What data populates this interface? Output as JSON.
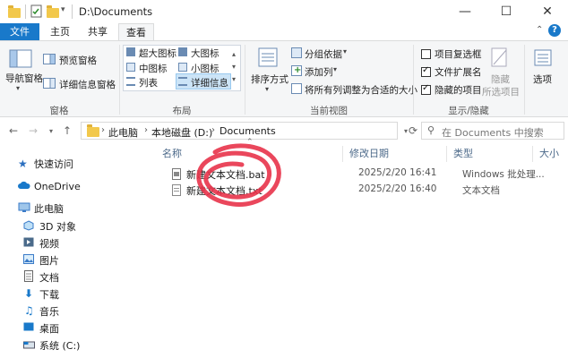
{
  "window": {
    "title": "D:\\Documents"
  },
  "tabs": {
    "file": "文件",
    "home": "主页",
    "share": "共享",
    "view": "查看"
  },
  "ribbon": {
    "panes": {
      "nav_pane": "导航窗格",
      "preview_pane": "预览窗格",
      "details_pane": "详细信息窗格",
      "group": "窗格"
    },
    "layout": {
      "xl_icons": "超大图标",
      "large_icons": "大图标",
      "medium_icons": "中图标",
      "small_icons": "小图标",
      "list": "列表",
      "details": "详细信息",
      "group": "布局"
    },
    "current_view": {
      "sort_by": "排序方式",
      "group_by": "分组依据",
      "add_columns": "添加列",
      "fit_columns": "将所有列调整为合适的大小",
      "group": "当前视图"
    },
    "show_hide": {
      "item_checkboxes": "项目复选框",
      "item_checkboxes_checked": false,
      "file_extensions": "文件扩展名",
      "file_extensions_checked": true,
      "hidden_items": "隐藏的项目",
      "hidden_items_checked": true,
      "hide": "隐藏",
      "hide_selected": "所选项目",
      "group": "显示/隐藏"
    },
    "options": "选项"
  },
  "address": {
    "path": [
      "此电脑",
      "本地磁盘 (D:)",
      "Documents"
    ],
    "search_placeholder": "在 Documents 中搜索"
  },
  "nav": {
    "items": [
      {
        "label": "快速访问",
        "icon": "star-icon"
      },
      {
        "label": "OneDrive",
        "icon": "cloud-icon"
      },
      {
        "label": "此电脑",
        "icon": "computer-icon"
      },
      {
        "label": "3D 对象",
        "icon": "cube-icon"
      },
      {
        "label": "视频",
        "icon": "video-icon"
      },
      {
        "label": "图片",
        "icon": "picture-icon"
      },
      {
        "label": "文档",
        "icon": "document-icon"
      },
      {
        "label": "下载",
        "icon": "download-icon"
      },
      {
        "label": "音乐",
        "icon": "music-icon"
      },
      {
        "label": "桌面",
        "icon": "desktop-icon"
      },
      {
        "label": "系统 (C:)",
        "icon": "drive-icon"
      }
    ]
  },
  "table": {
    "columns": [
      "名称",
      "修改日期",
      "类型",
      "大小"
    ],
    "rows": [
      {
        "name": "新建文本文档.bat",
        "modified": "2025/2/20 16:41",
        "type": "Windows 批处理...",
        "icon": "bat-file-icon"
      },
      {
        "name": "新建文本文档.txt",
        "modified": "2025/2/20 16:40",
        "type": "文本文档",
        "icon": "txt-file-icon"
      }
    ]
  },
  "colors": {
    "accent": "#1979ca",
    "annotation": "#e8334a"
  }
}
